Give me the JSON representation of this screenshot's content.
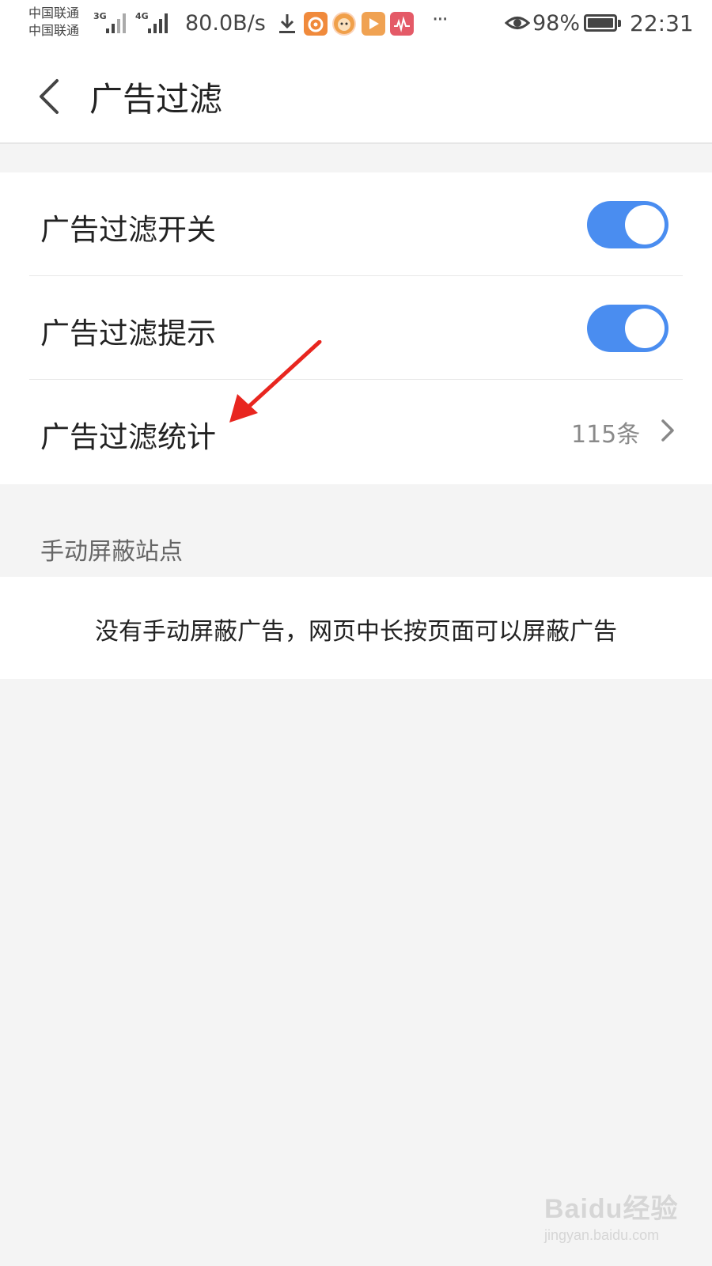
{
  "status_bar": {
    "carrier_1": "中国联通",
    "carrier_2": "中国联通",
    "net_type_1": "3G",
    "net_type_2": "4G",
    "net_speed": "80.0B/s",
    "more": "···",
    "battery_percent": "98%",
    "time": "22:31",
    "icons": [
      "download-icon",
      "uc-browser-icon",
      "lion-app-icon",
      "video-app-icon",
      "music-app-icon",
      "eye-icon",
      "battery-icon"
    ]
  },
  "header": {
    "title": "广告过滤",
    "back_icon": "back-arrow-icon"
  },
  "settings": {
    "rows": [
      {
        "label": "广告过滤开关",
        "toggle_on": true
      },
      {
        "label": "广告过滤提示",
        "toggle_on": true
      },
      {
        "label": "广告过滤统计",
        "value": "115条",
        "icon": "chevron-right-icon"
      }
    ]
  },
  "manual_block": {
    "section_title": "手动屏蔽站点",
    "empty_text": "没有手动屏蔽广告，网页中长按页面可以屏蔽广告"
  },
  "watermark": {
    "logo_text": "Baidu经验",
    "url_text": "jingyan.baidu.com"
  },
  "colors": {
    "toggle_on": "#4a8df0",
    "annotation_arrow": "#e8261f",
    "page_background": "#f4f4f4"
  }
}
